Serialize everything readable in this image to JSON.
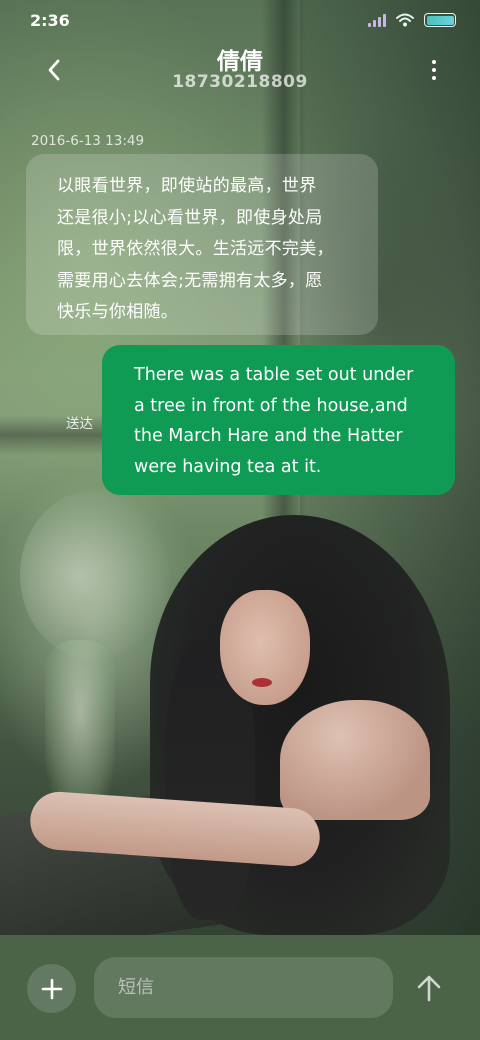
{
  "status_bar": {
    "time": "2:36",
    "icons": [
      "signal-icon",
      "wifi-icon",
      "battery-icon"
    ]
  },
  "header": {
    "contact_name": "倩倩",
    "contact_number": "18730218809",
    "back_icon": "chevron-left-icon",
    "more_icon": "more-vertical-icon"
  },
  "conversation": {
    "timestamp": "2016-6-13 13:49",
    "incoming_message": {
      "lines": [
        "以眼看世界，即使站的最高，世界",
        "还是很小;以心看世界，即使身处局",
        "限，世界依然很大。生活远不完美，",
        "需要用心去体会;无需拥有太多，愿",
        "快乐与你相随。"
      ]
    },
    "outgoing_message": {
      "lines": [
        "There was a table set out under",
        "a tree in front of the house,and",
        "the March Hare and the Hatter",
        "were having tea at it."
      ],
      "status": "送达",
      "bubble_color": "#109b55"
    }
  },
  "composer": {
    "add_icon": "plus-icon",
    "placeholder": "短信",
    "value": "",
    "send_icon": "arrow-up-icon"
  }
}
